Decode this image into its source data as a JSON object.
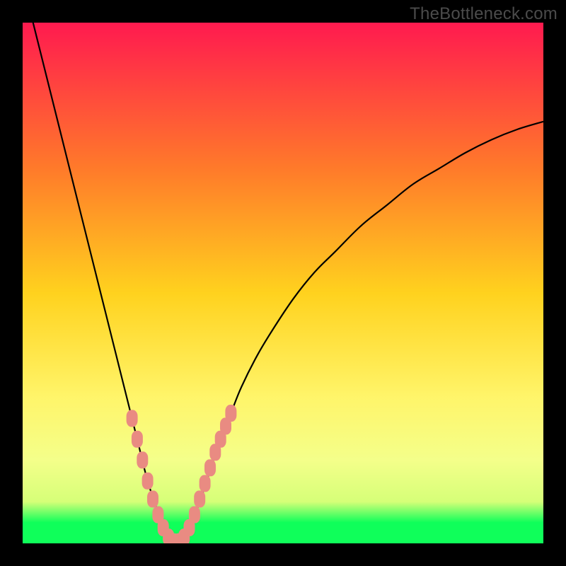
{
  "watermark": "TheBottleneck.com",
  "colors": {
    "frame": "#000000",
    "grad_top": "#ff1a4f",
    "grad_mid_upper": "#ff7a2a",
    "grad_mid": "#ffd21e",
    "grad_mid_lower": "#fff56a",
    "grad_band": "#f4ff8a",
    "grad_bottom": "#0fff5a",
    "curve": "#000000",
    "marker": "#e98b82"
  },
  "chart_data": {
    "type": "line",
    "title": "",
    "xlabel": "",
    "ylabel": "",
    "xlim": [
      0,
      100
    ],
    "ylim": [
      0,
      100
    ],
    "series": [
      {
        "name": "bottleneck-curve",
        "x": [
          0,
          2,
          4,
          6,
          8,
          10,
          12,
          14,
          16,
          18,
          20,
          22,
          24,
          26,
          27,
          28,
          29,
          30,
          31,
          32,
          34,
          36,
          38,
          40,
          42,
          45,
          48,
          52,
          56,
          60,
          65,
          70,
          75,
          80,
          85,
          90,
          95,
          100
        ],
        "y": [
          108,
          100,
          92,
          84,
          76,
          68,
          60,
          52,
          44,
          36,
          28,
          20,
          12,
          6,
          3,
          1,
          0,
          0,
          1,
          3,
          8,
          14,
          20,
          25,
          30,
          36,
          41,
          47,
          52,
          56,
          61,
          65,
          69,
          72,
          75,
          77.5,
          79.5,
          81
        ]
      }
    ],
    "markers": {
      "name": "highlight-band",
      "points": [
        {
          "x": 21.0,
          "y": 24.0
        },
        {
          "x": 22.0,
          "y": 20.0
        },
        {
          "x": 23.0,
          "y": 16.0
        },
        {
          "x": 24.0,
          "y": 12.0
        },
        {
          "x": 25.0,
          "y": 8.5
        },
        {
          "x": 26.0,
          "y": 5.5
        },
        {
          "x": 27.0,
          "y": 3.0
        },
        {
          "x": 28.0,
          "y": 1.2
        },
        {
          "x": 29.0,
          "y": 0.3
        },
        {
          "x": 30.0,
          "y": 0.3
        },
        {
          "x": 31.0,
          "y": 1.2
        },
        {
          "x": 32.0,
          "y": 3.0
        },
        {
          "x": 33.0,
          "y": 5.5
        },
        {
          "x": 34.0,
          "y": 8.5
        },
        {
          "x": 35.0,
          "y": 11.5
        },
        {
          "x": 36.0,
          "y": 14.5
        },
        {
          "x": 37.0,
          "y": 17.5
        },
        {
          "x": 38.0,
          "y": 20.0
        },
        {
          "x": 39.0,
          "y": 22.5
        },
        {
          "x": 40.0,
          "y": 25.0
        }
      ]
    }
  }
}
